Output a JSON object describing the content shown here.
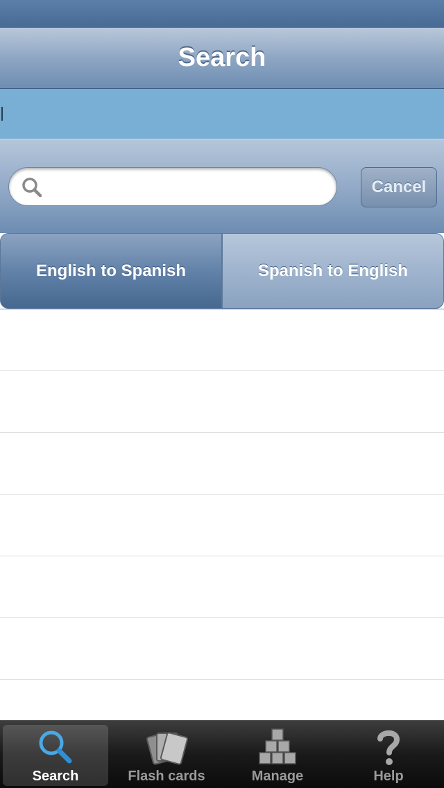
{
  "nav": {
    "title": "Search"
  },
  "search": {
    "placeholder": "",
    "value": "",
    "cancel_label": "Cancel"
  },
  "segments": [
    {
      "label": "English to Spanish",
      "selected": true
    },
    {
      "label": "Spanish to English",
      "selected": false
    }
  ],
  "tabs": [
    {
      "label": "Search",
      "icon": "magnifier-icon",
      "active": true
    },
    {
      "label": "Flash cards",
      "icon": "flash-cards-icon",
      "active": false
    },
    {
      "label": "Manage",
      "icon": "boxes-pyramid-icon",
      "active": false
    },
    {
      "label": "Help",
      "icon": "question-mark-icon",
      "active": false
    }
  ],
  "colors": {
    "accent": "#79aed5",
    "nav": "#8ea6c3",
    "tab_active_icon": "#4aa8e6"
  }
}
